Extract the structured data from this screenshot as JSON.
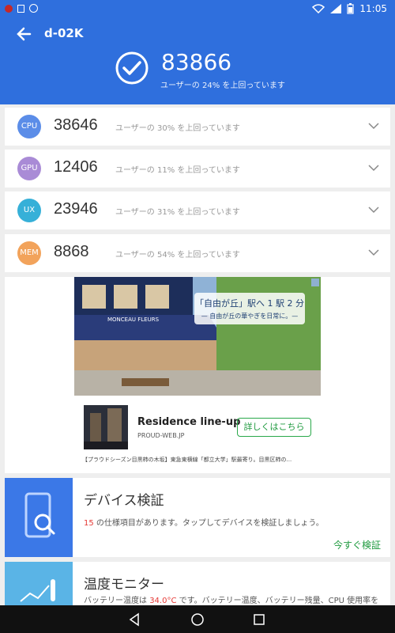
{
  "status_bar": {
    "time": "11:05"
  },
  "header": {
    "title": "d-02K",
    "total_score": "83866",
    "total_sub": "ユーザーの 24% を上回っています"
  },
  "scores": [
    {
      "badge": "CPU",
      "score": "38646",
      "pct": "ユーザーの 30% を上回っています",
      "color": "#5b8de8"
    },
    {
      "badge": "GPU",
      "score": "12406",
      "pct": "ユーザーの 11% を上回っています",
      "color": "#a98bd6"
    },
    {
      "badge": "UX",
      "score": "23946",
      "pct": "ユーザーの 31% を上回っています",
      "color": "#36b0d8"
    },
    {
      "badge": "MEM",
      "score": "8868",
      "pct": "ユーザーの 54% を上回っています",
      "color": "#f2a35b"
    }
  ],
  "ad": {
    "image_text_1": "「自由が丘」駅へ 1 駅 2 分",
    "image_text_2": "— 自由が丘の華やぎを日常に。—",
    "shop_sign": "MONCEAU FLEURS",
    "headline": "Residence line-up",
    "domain": "PROUD-WEB.JP",
    "cta": "詳しくはこちら",
    "footer": "【プラウドシーズン目黒柿の木坂】東急東横線「都立大学」駅最寄り。目黒区柿の..."
  },
  "device_card": {
    "title": "デバイス検証",
    "count": "15",
    "desc": " の仕様項目があります。タップしてデバイスを検証しましょう。",
    "action": "今すぐ検証"
  },
  "temp_card": {
    "title": "温度モニター",
    "desc_prefix": "バッテリー温度は ",
    "temp": "34.0°C",
    "desc_suffix": " です。バッテリー温度、バッテリー残量、CPU 使用率を詳"
  }
}
